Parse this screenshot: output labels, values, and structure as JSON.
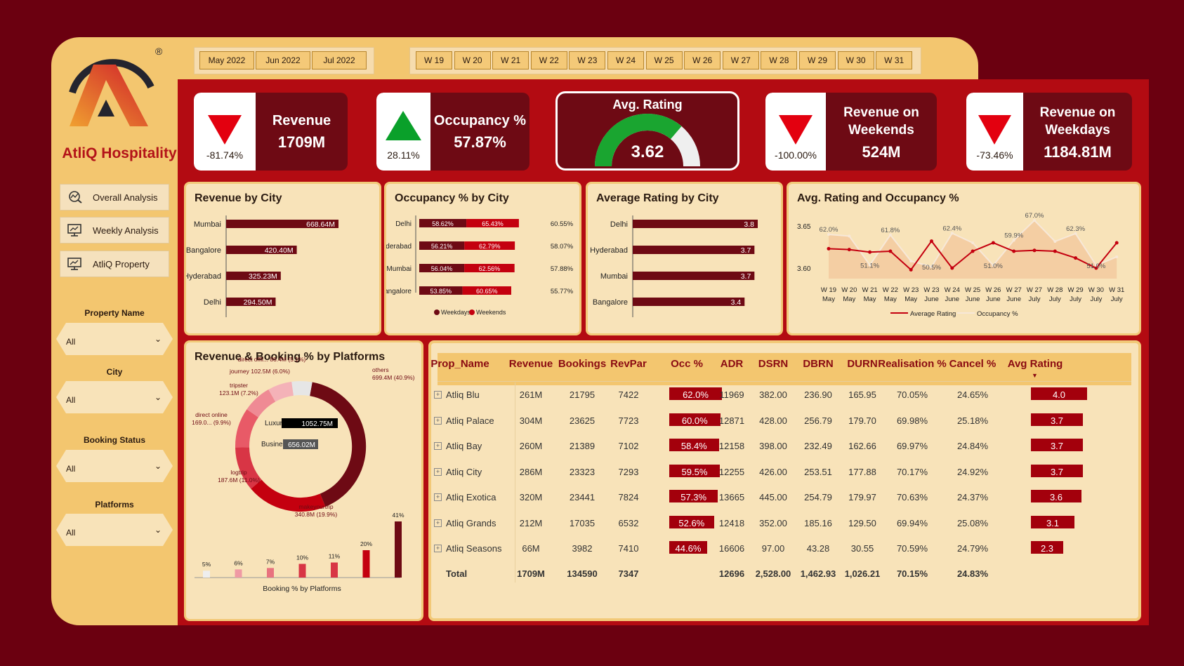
{
  "brand": {
    "name": "AtliQ Hospitality",
    "registered": "®",
    "primary": "#6e0a14",
    "accent": "#b30b12",
    "panel": "#f8e3b9",
    "gold": "#f3c66f"
  },
  "nav": [
    {
      "label": "Overall Analysis",
      "icon": "chart-search-icon"
    },
    {
      "label": "Weekly Analysis",
      "icon": "monitor-chart-icon"
    },
    {
      "label": "AtliQ Property",
      "icon": "monitor-chart-icon"
    }
  ],
  "filters": [
    {
      "label": "Property Name",
      "value": "All"
    },
    {
      "label": "City",
      "value": "All"
    },
    {
      "label": "Booking Status",
      "value": "All"
    },
    {
      "label": "Platforms",
      "value": "All"
    }
  ],
  "months": [
    "May 2022",
    "Jun 2022",
    "Jul 2022"
  ],
  "weeks": [
    "W 19",
    "W 20",
    "W 21",
    "W 22",
    "W 23",
    "W 24",
    "W 25",
    "W 26",
    "W 27",
    "W 28",
    "W 29",
    "W 30",
    "W 31"
  ],
  "kpis": {
    "revenue": {
      "title": "Revenue",
      "value": "1709M",
      "change": "-81.74%",
      "direction": "down"
    },
    "occupancy": {
      "title": "Occupancy %",
      "value": "57.87%",
      "change": "28.11%",
      "direction": "up"
    },
    "rating": {
      "title": "Avg. Rating",
      "value": "3.62",
      "max": 5
    },
    "weekends": {
      "title1": "Revenue on",
      "title2": "Weekends",
      "value": "524M",
      "change": "-100.00%",
      "direction": "down"
    },
    "weekdays": {
      "title1": "Revenue on",
      "title2": "Weekdays",
      "value": "1184.81M",
      "change": "-73.46%",
      "direction": "down"
    }
  },
  "chart_data": [
    {
      "type": "bar",
      "title": "Revenue by City",
      "categories": [
        "Mumbai",
        "Bangalore",
        "Hyderabad",
        "Delhi"
      ],
      "values": [
        668.64,
        420.4,
        325.23,
        294.5
      ],
      "labels": [
        "668.64M",
        "420.40M",
        "325.23M",
        "294.50M"
      ]
    },
    {
      "type": "bar",
      "title": "Occupancy % by City",
      "categories": [
        "Delhi",
        "Hyderabad",
        "Mumbai",
        "Bangalore"
      ],
      "series": [
        {
          "name": "Weekdays",
          "values": [
            58.62,
            56.21,
            56.04,
            53.85
          ],
          "labels": [
            "58.62%",
            "56.21%",
            "56.04%",
            "53.85%"
          ]
        },
        {
          "name": "Weekends",
          "values": [
            65.43,
            62.79,
            62.56,
            60.65
          ],
          "labels": [
            "65.43%",
            "62.79%",
            "62.56%",
            "60.65%"
          ]
        }
      ],
      "totals": [
        "60.55%",
        "58.07%",
        "57.88%",
        "55.77%"
      ]
    },
    {
      "type": "bar",
      "title": "Average Rating by City",
      "categories": [
        "Delhi",
        "Hyderabad",
        "Mumbai",
        "Bangalore"
      ],
      "values": [
        3.8,
        3.7,
        3.7,
        3.4
      ],
      "labels": [
        "3.8",
        "3.7",
        "3.7",
        "3.4"
      ]
    },
    {
      "type": "line",
      "title": "Avg. Rating and Occupancy %",
      "x": [
        "W 19",
        "W 20",
        "W 21",
        "W 22",
        "W 23",
        "W 23",
        "W 24",
        "W 25",
        "W 26",
        "W 27",
        "W 27",
        "W 28",
        "W 29",
        "W 30",
        "W 31"
      ],
      "x2": [
        "May",
        "May",
        "May",
        "May",
        "May",
        "June",
        "June",
        "June",
        "June",
        "June",
        "July",
        "July",
        "July",
        "July",
        "July"
      ],
      "y_ticks": [
        "3.65",
        "3.60"
      ],
      "series": [
        {
          "name": "Average Rating",
          "values": [
            3.623,
            3.622,
            3.619,
            3.62,
            3.598,
            3.632,
            3.6,
            3.62,
            3.63,
            3.62,
            3.621,
            3.62,
            3.612,
            3.6,
            3.63
          ]
        },
        {
          "name": "Occupancy %",
          "values": [
            62.0,
            61.4,
            51.1,
            61.8,
            52.5,
            50.5,
            62.4,
            59.0,
            51.0,
            59.9,
            67.0,
            59.5,
            62.3,
            51.0,
            54.0
          ]
        }
      ],
      "labels": [
        "62.0%",
        "51.1%",
        "61.8%",
        "50.5%",
        "62.4%",
        "51.0%",
        "59.9%",
        "67.0%",
        "62.3%",
        "51.0%"
      ]
    },
    {
      "type": "pie",
      "title": "Revenue & Booking % by Platforms",
      "segments": [
        {
          "name": "others",
          "value": 699.4,
          "label": "others\n699.4M (40.9%)"
        },
        {
          "name": "makeyourtrip",
          "value": 340.8,
          "label": "makeyourtrip\n340.8M (19.9%)"
        },
        {
          "name": "logtrip",
          "value": 187.6,
          "label": "logtrip\n187.6M (11.0%)"
        },
        {
          "name": "direct online",
          "value": 169.0,
          "label": "direct online\n169.0... (9.9%)"
        },
        {
          "name": "tripster",
          "value": 123.1,
          "label": "tripster\n123.1M (7.2%)"
        },
        {
          "name": "journey",
          "value": 102.5,
          "label": "journey 102.5M (6.0%)"
        },
        {
          "name": "direct offline",
          "value": 86.4,
          "label": "direct offli... 86.4M (5.1%)"
        }
      ],
      "center": [
        {
          "label": "Luxury",
          "value": "1052.75M"
        },
        {
          "label": "Business",
          "value": "656.02M"
        }
      ]
    },
    {
      "type": "bar",
      "title": "Booking % by Platforms",
      "values": [
        5,
        6,
        7,
        10,
        11,
        20,
        41
      ],
      "labels": [
        "5%",
        "6%",
        "7%",
        "10%",
        "11%",
        "20%",
        "41%"
      ]
    }
  ],
  "table": {
    "headers": [
      "Prop_Name",
      "Revenue",
      "Bookings",
      "RevPar",
      "Occ %",
      "ADR",
      "DSRN",
      "DBRN",
      "DURN",
      "Realisation %",
      "Cancel %",
      "Avg Rating"
    ],
    "rows": [
      [
        "Atliq Blu",
        "261M",
        "21795",
        "7422",
        "62.0%",
        "11969",
        "382.00",
        "236.90",
        "165.95",
        "70.05%",
        "24.65%",
        "4.0"
      ],
      [
        "Atliq Palace",
        "304M",
        "23625",
        "7723",
        "60.0%",
        "12871",
        "428.00",
        "256.79",
        "179.70",
        "69.98%",
        "25.18%",
        "3.7"
      ],
      [
        "Atliq Bay",
        "260M",
        "21389",
        "7102",
        "58.4%",
        "12158",
        "398.00",
        "232.49",
        "162.66",
        "69.97%",
        "24.84%",
        "3.7"
      ],
      [
        "Atliq City",
        "286M",
        "23323",
        "7293",
        "59.5%",
        "12255",
        "426.00",
        "253.51",
        "177.88",
        "70.17%",
        "24.92%",
        "3.7"
      ],
      [
        "Atliq Exotica",
        "320M",
        "23441",
        "7824",
        "57.3%",
        "13665",
        "445.00",
        "254.79",
        "179.97",
        "70.63%",
        "24.37%",
        "3.6"
      ],
      [
        "Atliq Grands",
        "212M",
        "17035",
        "6532",
        "52.6%",
        "12418",
        "352.00",
        "185.16",
        "129.50",
        "69.94%",
        "25.08%",
        "3.1"
      ],
      [
        "Atliq Seasons",
        "66M",
        "3982",
        "7410",
        "44.6%",
        "16606",
        "97.00",
        "43.28",
        "30.55",
        "70.59%",
        "24.79%",
        "2.3"
      ]
    ],
    "occ_values": [
      62.0,
      60.0,
      58.4,
      59.5,
      57.3,
      52.6,
      44.6
    ],
    "rating_values": [
      4.0,
      3.7,
      3.7,
      3.7,
      3.6,
      3.1,
      2.3
    ],
    "total": [
      "Total",
      "1709M",
      "134590",
      "7347",
      "",
      "12696",
      "2,528.00",
      "1,462.93",
      "1,026.21",
      "70.15%",
      "24.83%",
      ""
    ]
  }
}
